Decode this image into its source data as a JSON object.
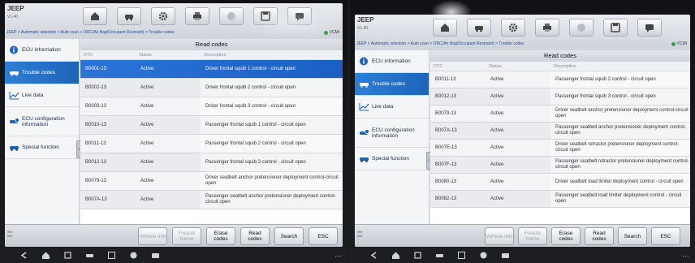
{
  "app": {
    "title": "JEEP",
    "version": "V1.40"
  },
  "toolbar": {
    "icons": [
      "home-icon",
      "vehicle-swap-icon",
      "settings-icon",
      "print-icon",
      "help-icon",
      "save-icon",
      "chat-icon"
    ]
  },
  "breadcrumb": "JEEP > Automatic selection > Auto scan > ORC(Air Bag/Occupant Restraint) > Trouble codes",
  "vci_label": "VCMI",
  "sidebar": {
    "items": [
      {
        "label": "ECU information"
      },
      {
        "label": "Trouble codes"
      },
      {
        "label": "Live data"
      },
      {
        "label": "ECU configuration information"
      },
      {
        "label": "Special function"
      }
    ]
  },
  "table": {
    "title": "Read codes",
    "columns": [
      "DTC",
      "Status",
      "Description"
    ]
  },
  "left_rows": [
    {
      "dtc": "B0001-13",
      "status": "Active",
      "desc": "Driver frontal squib 1 control - circuit open",
      "selected": true
    },
    {
      "dtc": "B0002-13",
      "status": "Active",
      "desc": "Driver frontal squib 2 control - circuit open"
    },
    {
      "dtc": "B0003-13",
      "status": "Active",
      "desc": "Driver frontal squib 3 control - circuit open"
    },
    {
      "dtc": "B0010-13",
      "status": "Active",
      "desc": "Passenger frontal squib 1 control - circuit open"
    },
    {
      "dtc": "B0011-13",
      "status": "Active",
      "desc": "Passenger frontal squib 2 control - circuit open"
    },
    {
      "dtc": "B0012-13",
      "status": "Active",
      "desc": "Passenger frontal squib 3 control - circuit open"
    },
    {
      "dtc": "B0079-13",
      "status": "Active",
      "desc": "Driver seatbelt anchor pretensioner deployment control-circuit open"
    },
    {
      "dtc": "B007A-13",
      "status": "Active",
      "desc": "Passenger seatbelt anchor pretensioner deployment control-circuit open"
    }
  ],
  "right_rows": [
    {
      "dtc": "B0011-13",
      "status": "Active",
      "desc": "Passenger frontal squib 2 control - circuit open"
    },
    {
      "dtc": "B0012-13",
      "status": "Active",
      "desc": "Passenger frontal squib 3 control - circuit open"
    },
    {
      "dtc": "B0079-13",
      "status": "Active",
      "desc": "Driver seatbelt anchor pretensioner deployment control-circuit open"
    },
    {
      "dtc": "B007A-13",
      "status": "Active",
      "desc": "Passenger seatbelt anchor pretensioner deployment control-circuit open"
    },
    {
      "dtc": "B007E-13",
      "status": "Active",
      "desc": "Driver seatbelt retractor pretensioner deployment control-circuit open"
    },
    {
      "dtc": "B007F-13",
      "status": "Active",
      "desc": "Passenger seatbelt retractor pretensioner deployment control-circuit open"
    },
    {
      "dtc": "B0080-13",
      "status": "Active",
      "desc": "Driver seatbelt load limiter deployment control - circuit open"
    },
    {
      "dtc": "B0082-13",
      "status": "Active",
      "desc": "Passenger seatbelt load limiter deployment control - circuit open"
    }
  ],
  "bottom": {
    "vehicle_info": "Vehicle info",
    "freeze_frame": "Freeze frame",
    "erase_codes": "Erase codes",
    "read_codes": "Read codes",
    "search": "Search",
    "esc": "ESC"
  },
  "colors": {
    "accent": "#1e64b8",
    "selected_row": "#1b5fc4",
    "ok": "#2aa43a"
  }
}
